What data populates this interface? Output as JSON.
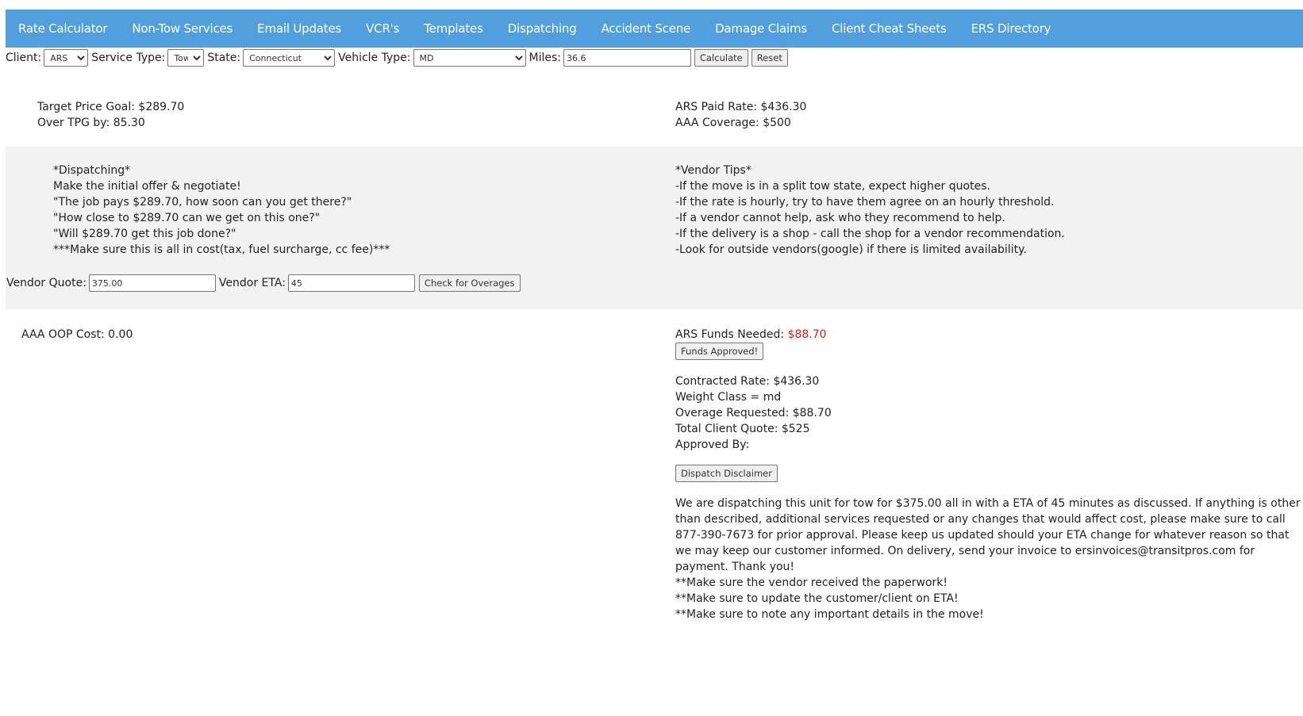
{
  "nav": [
    "Rate Calculator",
    "Non-Tow Services",
    "Email Updates",
    "VCR's",
    "Templates",
    "Dispatching",
    "Accident Scene",
    "Damage Claims",
    "Client Cheat Sheets",
    "ERS Directory"
  ],
  "controls": {
    "client_label": "Client:",
    "client_value": "ARS",
    "service_label": "Service Type:",
    "service_value": "Tow",
    "state_label": "State:",
    "state_value": "Connecticut",
    "vehicle_label": "Vehicle Type:",
    "vehicle_value": "MD",
    "miles_label": "Miles:",
    "miles_value": "36.6",
    "calculate": "Calculate",
    "reset": "Reset"
  },
  "summary": {
    "target_price": "Target Price Goal: $289.70",
    "over_tpg": "Over TPG by: 85.30",
    "paid_rate": "ARS Paid Rate: $436.30",
    "coverage": "AAA Coverage: $500"
  },
  "dispatching": {
    "heading": "*Dispatching*",
    "lines": [
      "Make the initial offer & negotiate!",
      "\"The job pays $289.70, how soon can you get there?\"",
      "\"How close to $289.70 can we get on this one?\"",
      "\"Will $289.70 get this job done?\"",
      "***Make sure this is all in cost(tax, fuel surcharge, cc fee)***"
    ]
  },
  "vendor_tips": {
    "heading": "*Vendor Tips*",
    "lines": [
      "-If the move is in a split tow state, expect higher quotes.",
      "-If the rate is hourly, try to have them agree on an hourly threshold.",
      "-If a vendor cannot help, ask who they recommend to help.",
      "-If the delivery is a shop - call the shop for a vendor recommendation.",
      "-Look for outside vendors(google) if there is limited availability."
    ]
  },
  "vendor": {
    "quote_label": "Vendor Quote:",
    "quote_value": "375.00",
    "eta_label": "Vendor ETA:",
    "eta_value": "45",
    "check": "Check for Overages"
  },
  "results": {
    "oop": "AAA OOP Cost: 0.00",
    "funds_label": "ARS Funds Needed: ",
    "funds_value": "$88.70",
    "funds_button": "Funds Approved!",
    "details": [
      "Contracted Rate: $436.30",
      "Weight Class = md",
      "Overage Requested: $88.70",
      "Total Client Quote: $525",
      "Approved By:"
    ],
    "disclaimer_button": "Dispatch Disclaimer",
    "disclaimer": "We are dispatching this unit for tow for $375.00 all in with a ETA of 45 minutes as discussed. If anything is other than described, additional services requested or any changes that would affect cost, please make sure to call 877-390-7673 for prior approval. Please keep us updated should your ETA change for whatever reason so that we may keep our customer informed. On delivery, send your invoice to ersinvoices@transitpros.com for payment. Thank you!",
    "reminders": [
      "**Make sure the vendor received the paperwork!",
      "**Make sure to update the customer/client on ETA!",
      "**Make sure to note any important details in the move!"
    ]
  },
  "colors": {
    "nav_bg": "#519fdd",
    "panel_bg": "#f2f2f2",
    "alert": "#e01b1b"
  }
}
